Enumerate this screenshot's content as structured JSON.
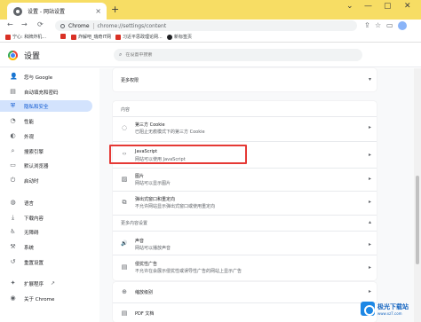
{
  "browser": {
    "tab_title": "设置 - 网站设置",
    "tab_close": "×",
    "new_tab": "+",
    "window_controls": [
      "⌄",
      "—",
      "▢",
      "✕"
    ],
    "omnibox_chip": "Chrome",
    "url": "chrome://settings/content",
    "nav": {
      "back": "←",
      "forward": "→",
      "reload": "⟳"
    },
    "toolbar_icons": {
      "share": "⇪",
      "star": "☆",
      "split": "▭"
    }
  },
  "bookmarks": [
    {
      "label": "宁心: 和牌炸机...",
      "color": "#d93025"
    },
    {
      "label": "",
      "color": "#d93025"
    },
    {
      "label": "炸解吧_瑞奇IT网",
      "color": "#d93025"
    },
    {
      "label": "习近平思政理论网...",
      "color": "#d93025"
    },
    {
      "label": "新标签页",
      "color": "#202124"
    }
  ],
  "settings": {
    "title": "设置",
    "search_placeholder": "在设置中搜索",
    "search_icon": "⌕"
  },
  "sidebar": {
    "items": [
      {
        "label": "您与 Google",
        "icon": "person-icon",
        "glyph": "👤"
      },
      {
        "label": "自动填充和密码",
        "icon": "clipboard-icon",
        "glyph": "▤"
      },
      {
        "label": "隐私和安全",
        "icon": "shield-icon",
        "glyph": "⛨"
      },
      {
        "label": "性能",
        "icon": "gauge-icon",
        "glyph": "◔"
      },
      {
        "label": "外观",
        "icon": "palette-icon",
        "glyph": "◐"
      },
      {
        "label": "搜索引擎",
        "icon": "search-icon",
        "glyph": "⌕"
      },
      {
        "label": "默认浏览器",
        "icon": "browser-icon",
        "glyph": "▭"
      },
      {
        "label": "启动时",
        "icon": "power-icon",
        "glyph": "⏻"
      },
      {
        "label": "语言",
        "icon": "globe-icon",
        "glyph": "◍"
      },
      {
        "label": "下载内容",
        "icon": "download-icon",
        "glyph": "⤓"
      },
      {
        "label": "无障碍",
        "icon": "accessibility-icon",
        "glyph": "♿"
      },
      {
        "label": "系统",
        "icon": "wrench-icon",
        "glyph": "⚒"
      },
      {
        "label": "重置设置",
        "icon": "reset-icon",
        "glyph": "↺"
      },
      {
        "label": "扩展程序",
        "icon": "puzzle-icon",
        "glyph": "✦"
      },
      {
        "label": "关于 Chrome",
        "icon": "chrome-icon",
        "glyph": "◉"
      }
    ],
    "external_link_glyph": "↗"
  },
  "main": {
    "more_permissions": "更多权限",
    "content_label": "内容",
    "content_rows": [
      {
        "title": "第三方 Cookie",
        "subtitle": "已阻止无痕模式下的第三方 Cookie",
        "icon": "cookie-icon",
        "glyph": "◌"
      },
      {
        "title": "JavaScript",
        "subtitle": "网站可以使用 JavaScript",
        "icon": "code-icon",
        "glyph": "‹›"
      },
      {
        "title": "图片",
        "subtitle": "网站可以显示图片",
        "icon": "image-icon",
        "glyph": "▨"
      },
      {
        "title": "弹出式窗口和重定向",
        "subtitle": "不允许网站显示弹出式窗口或使用重定向",
        "icon": "popup-icon",
        "glyph": "⧉"
      }
    ],
    "more_content_settings": "更多内容设置",
    "more_rows": [
      {
        "title": "声音",
        "subtitle": "网站可以播放声音",
        "icon": "volume-icon",
        "glyph": "🔊"
      },
      {
        "title": "侵扰性广告",
        "subtitle": "不允许在会展示侵扰性或误导性广告的网站上显示广告",
        "icon": "ads-icon",
        "glyph": "▤"
      },
      {
        "title": "缩放级别",
        "subtitle": "",
        "icon": "zoom-icon",
        "glyph": "⊕"
      },
      {
        "title": "PDF 文档",
        "subtitle": "",
        "icon": "pdf-icon",
        "glyph": "▤"
      }
    ],
    "arrow": "▸",
    "expand_arrow": "▾",
    "collapse_arrow": "▴"
  },
  "watermark": {
    "main": "极光下载站",
    "sub": "www.xz7.com"
  },
  "colors": {
    "tab_strip": "#f7dd64",
    "active_nav": "#d3e3fd",
    "highlight_border": "#e53935",
    "accent": "#0b57d0"
  }
}
